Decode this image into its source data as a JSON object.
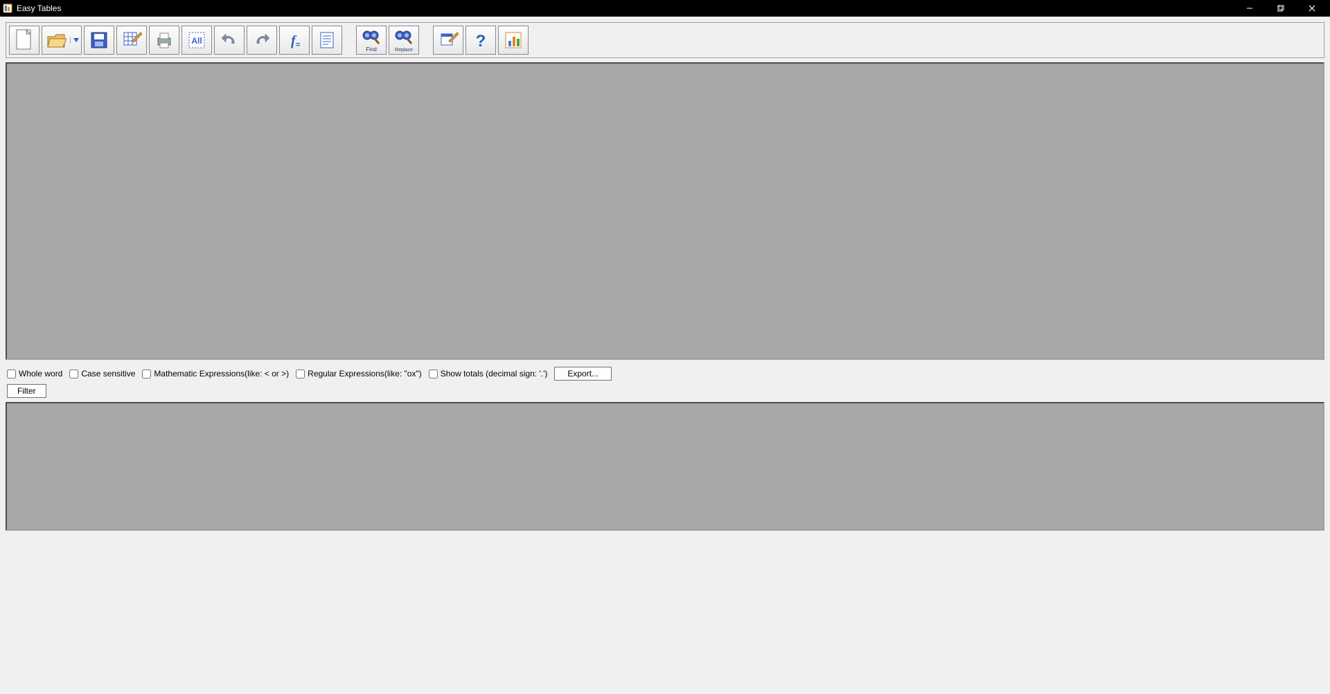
{
  "window": {
    "title": "Easy Tables"
  },
  "filter": {
    "whole_word": "Whole word",
    "case_sensitive": "Case sensitive",
    "math_expr": "Mathematic Expressions(like: < or >)",
    "regex": "Regular Expressions(like: \"ox\")",
    "show_totals": "Show totals (decimal sign: '.')",
    "export_btn": "Export...",
    "filter_btn": "Filter"
  },
  "toolbar": {
    "new": "New",
    "open": "Open",
    "save": "Save",
    "edit": "Edit Table",
    "print": "Print",
    "select_all": "Select All",
    "undo": "Undo",
    "redo": "Redo",
    "formula": "Formula",
    "script": "Script",
    "find": "Find",
    "replace": "Replace",
    "options": "Options",
    "help": "Help",
    "chart": "Chart"
  }
}
